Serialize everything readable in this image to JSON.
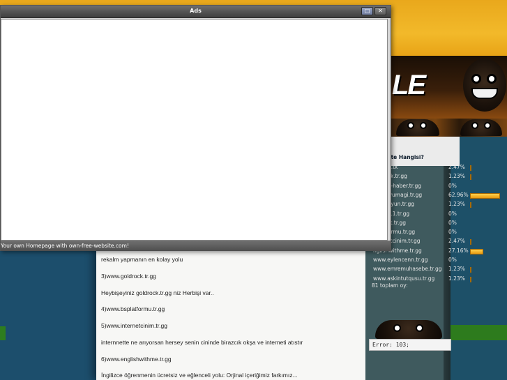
{
  "popup": {
    "title": "Ads",
    "status_text": "Your own Homepage with own-free-website.com!",
    "maximize_symbol": "□",
    "close_symbol": "✕"
  },
  "banner": {
    "logo_text": "LE"
  },
  "content": {
    "lines": [
      "rekalm yapmanın en kolay yolu",
      "3)www.goldrock.tr.gg",
      "Heybişeyiniz goldrock.tr.gg niz Herbişi var..",
      "4)www.bsplatformu.tr.gg",
      "5)www.internetcinim.tr.gg",
      "internnette ne arıyorsan hersey senin cininde birazcık okşa ve interneti atıstır",
      "6)www.englishwithme.tr.gg",
      "İngilizce öğrenmenin ücretsiz ve eğlenceli yolu: Orjinal içeriğimiz farkımız..."
    ]
  },
  "poll": {
    "title": "ite Hangisi?",
    "rows": [
      {
        "name": "adubul.tk",
        "percent": "2.47%",
        "value": 2.47
      },
      {
        "name": "otakolik.tr.gg",
        "percent": "1.23%",
        "value": 1.23
      },
      {
        "name": "iltekno-haber.tr.gg",
        "percent": "0%",
        "value": 0
      },
      {
        "name": "ilgininyumagi.tr.gg",
        "percent": "62.96%",
        "value": 62.96
      },
      {
        "name": "endaloyun.tr.gg",
        "percent": "1.23%",
        "value": 1.23
      },
      {
        "name": "eklam11.tr.gg",
        "percent": "0%",
        "value": 0
      },
      {
        "name": "oldrock.tr.gg",
        "percent": "0%",
        "value": 0
      },
      {
        "name": "splatformu.tr.gg",
        "percent": "0%",
        "value": 0
      },
      {
        "name": "nternetcinim.tr.gg",
        "percent": "2.47%",
        "value": 2.47
      },
      {
        "name": "nglishwithme.tr.gg",
        "percent": "27.16%",
        "value": 27.16
      },
      {
        "name": "www.eylencenn.tr.gg",
        "percent": "0%",
        "value": 0
      },
      {
        "name": "www.emremuhasebe.tr.gg",
        "percent": "1.23%",
        "value": 1.23
      },
      {
        "name": "www.askintutqusu.tr.gg",
        "percent": "1.23%",
        "value": 1.23
      }
    ],
    "total_text": "81 toplam oy:"
  },
  "error": {
    "text": "Error: 103;"
  },
  "colors": {
    "bar_fill": "#f2b52a",
    "panel": "#3f5a5e",
    "titlebar": "#545454"
  }
}
